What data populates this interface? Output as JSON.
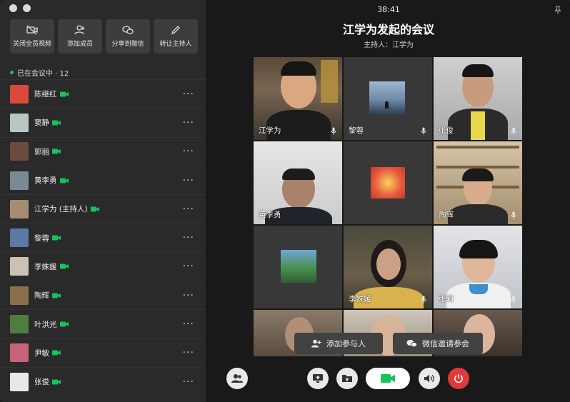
{
  "window": {
    "timer": "38:41"
  },
  "meeting": {
    "title": "江学为发起的会议",
    "host": "主持人：江学为"
  },
  "actions": [
    {
      "label": "关闭全员视频",
      "icon": "video-off-icon"
    },
    {
      "label": "添加成员",
      "icon": "add-person-icon"
    },
    {
      "label": "分享到微信",
      "icon": "wechat-icon"
    },
    {
      "label": "转让主持人",
      "icon": "pen-icon"
    }
  ],
  "status": {
    "label": "已在会议中 · 12"
  },
  "members": [
    {
      "name": "陈继红",
      "avatar": "#d94a3a"
    },
    {
      "name": "窦静",
      "avatar": "#b9c7c2"
    },
    {
      "name": "郭丽",
      "avatar": "#6b4a3f"
    },
    {
      "name": "黄李勇",
      "avatar": "#7a8a95"
    },
    {
      "name": "江学为 (主持人)",
      "avatar": "#a58d74"
    },
    {
      "name": "黎蓉",
      "avatar": "#5b7aa6"
    },
    {
      "name": "李姝媛",
      "avatar": "#c9c2b5"
    },
    {
      "name": "陶辉",
      "avatar": "#8a6f4c"
    },
    {
      "name": "叶洪光",
      "avatar": "#4e7d3f"
    },
    {
      "name": "尹敏",
      "avatar": "#c7647a"
    },
    {
      "name": "张俊",
      "avatar": "#e8e8e8"
    }
  ],
  "tiles": [
    {
      "name": "江学为",
      "mic": true
    },
    {
      "name": "黎蓉",
      "mic": true
    },
    {
      "name": "张俊",
      "mic": true
    },
    {
      "name": "黄李勇",
      "mic": false
    },
    {
      "name": "",
      "mic": false
    },
    {
      "name": "陶辉",
      "mic": true
    },
    {
      "name": "",
      "mic": false
    },
    {
      "name": "李姝媛",
      "mic": true
    },
    {
      "name": "张莉",
      "mic": true
    },
    {
      "name": "",
      "mic": false
    },
    {
      "name": "",
      "mic": false
    },
    {
      "name": "",
      "mic": false
    }
  ],
  "buttons": {
    "add_participant": "添加参与人",
    "wechat_invite": "微信邀请参会"
  },
  "colors": {
    "accent_green": "#16c35c",
    "hangup_red": "#e0393b"
  }
}
